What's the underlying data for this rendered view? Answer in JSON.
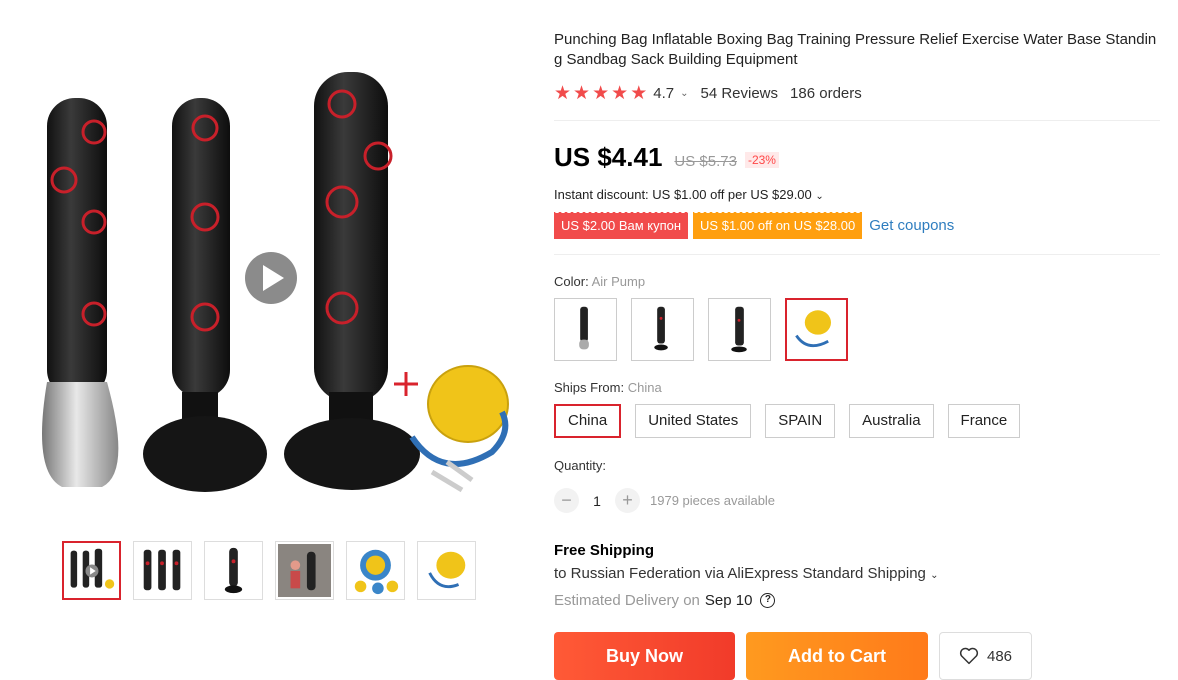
{
  "product": {
    "title": "Punching Bag Inflatable Boxing Bag Training Pressure Relief Exercise Water Base Standing Sandbag Sack Building Equipment",
    "rating": "4.7",
    "reviews": "54 Reviews",
    "orders": "186 orders"
  },
  "price": {
    "current": "US $4.41",
    "original": "US $5.73",
    "discount": "-23%"
  },
  "instant_discount": "Instant discount: US $1.00 off per US $29.00",
  "coupons": {
    "red": "US $2.00 Вам купон",
    "orange": "US $1.00 off on US $28.00",
    "link": "Get coupons"
  },
  "color": {
    "label": "Color:",
    "selected": "Air Pump",
    "options": [
      "bag-1",
      "bag-2",
      "bag-3",
      "air-pump"
    ]
  },
  "ships_from": {
    "label": "Ships From:",
    "selected": "China",
    "options": [
      "China",
      "United States",
      "SPAIN",
      "Australia",
      "France"
    ]
  },
  "quantity": {
    "label": "Quantity:",
    "minus": "−",
    "value": "1",
    "plus": "+",
    "available": "1979 pieces available"
  },
  "shipping": {
    "title": "Free Shipping",
    "destination": "to Russian Federation via AliExpress Standard Shipping",
    "estimated_label": "Estimated Delivery on",
    "date": "Sep 10",
    "help": "?"
  },
  "buttons": {
    "buy": "Buy Now",
    "cart": "Add to Cart",
    "wishlist_count": "486"
  },
  "colors": {
    "accent_red": "#d9232d",
    "star_red": "#f14b4b",
    "link_blue": "#2e7dbf",
    "cart_orange": "#ff8a1a"
  }
}
